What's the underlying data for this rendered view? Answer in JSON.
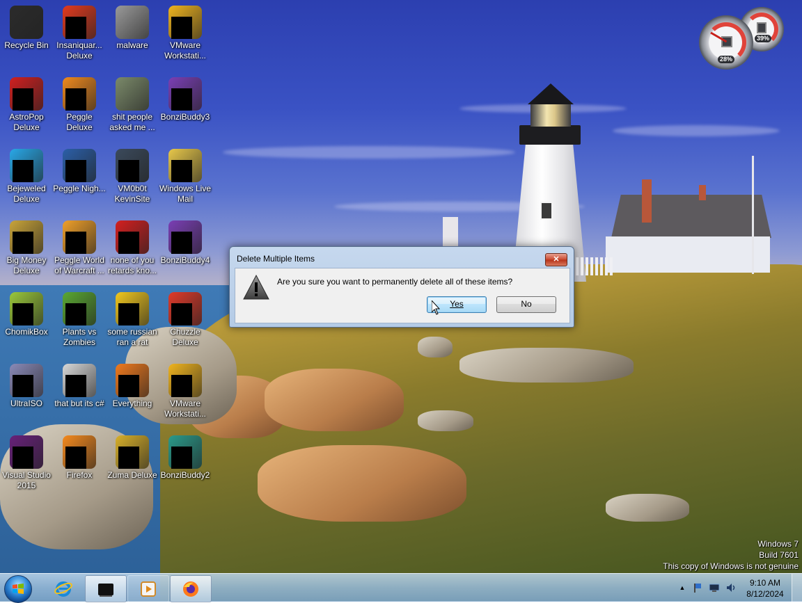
{
  "desktop": {
    "icons": [
      {
        "label": "Recycle Bin",
        "icon": "recycle-bin-icon",
        "color": "#2b2b2b",
        "redacted": false
      },
      {
        "label": "Insaniquar... Deluxe",
        "icon": "insaniquarium-icon",
        "color": "#e23a1e",
        "redacted": true
      },
      {
        "label": "malware",
        "icon": "folder-icon",
        "color": "#9a9a9a",
        "redacted": false
      },
      {
        "label": "VMware Workstati...",
        "icon": "vmware-icon",
        "color": "#f0b41e",
        "redacted": true
      },
      {
        "label": "AstroPop Deluxe",
        "icon": "astropop-icon",
        "color": "#d02020",
        "redacted": true
      },
      {
        "label": "Peggle Deluxe",
        "icon": "peggle-icon",
        "color": "#f08a1e",
        "redacted": true
      },
      {
        "label": "shit people asked me ...",
        "icon": "folder-icon",
        "color": "#7b8a6a",
        "redacted": false
      },
      {
        "label": "BonziBuddy3",
        "icon": "bonzibuddy-icon",
        "color": "#7b3fb5",
        "redacted": true
      },
      {
        "label": "Bejeweled Deluxe",
        "icon": "bejeweled-icon",
        "color": "#28a8e8",
        "redacted": true
      },
      {
        "label": "Peggle Nigh...",
        "icon": "peggle-nights-icon",
        "color": "#2b5fa8",
        "redacted": true
      },
      {
        "label": "VM0b0t KevinSite",
        "icon": "monitor-icon",
        "color": "#3b4a5c",
        "redacted": true
      },
      {
        "label": "Windows Live Mail",
        "icon": "mail-icon",
        "color": "#e8c84a",
        "redacted": true
      },
      {
        "label": "Big Money Deluxe",
        "icon": "big-money-icon",
        "color": "#c9a43a",
        "redacted": true
      },
      {
        "label": "Peggle World of Warcraft ...",
        "icon": "peggle-wow-icon",
        "color": "#f0a02a",
        "redacted": true
      },
      {
        "label": "none of you retards kno...",
        "icon": "red-circle-icon",
        "color": "#d42020",
        "redacted": true
      },
      {
        "label": "BonziBuddy4",
        "icon": "bonzibuddy-icon",
        "color": "#7b3fb5",
        "redacted": true
      },
      {
        "label": "ChomikBox",
        "icon": "chomikbox-icon",
        "color": "#9ac83a",
        "redacted": true
      },
      {
        "label": "Plants vs Zombies",
        "icon": "plants-vs-zombies-icon",
        "color": "#5aa832",
        "redacted": true
      },
      {
        "label": "some russian ran a rat",
        "icon": "lightshot-icon",
        "color": "#f2c81e",
        "redacted": true
      },
      {
        "label": "Chuzzle Deluxe",
        "icon": "chuzzle-icon",
        "color": "#e03a2a",
        "redacted": true
      },
      {
        "label": "UltraISO",
        "icon": "ultraiso-icon",
        "color": "#8a8ab8",
        "redacted": true
      },
      {
        "label": "that but its c#",
        "icon": "copy-icon",
        "color": "#d8d8d8",
        "redacted": true
      },
      {
        "label": "Everything",
        "icon": "everything-icon",
        "color": "#f07a1e",
        "redacted": true
      },
      {
        "label": "VMware Workstati...",
        "icon": "vmware-icon",
        "color": "#f0b41e",
        "redacted": true
      },
      {
        "label": "Visual Studio 2015",
        "icon": "visual-studio-icon",
        "color": "#68217a",
        "redacted": true
      },
      {
        "label": "Firefox",
        "icon": "firefox-icon",
        "color": "#f58a1e",
        "redacted": true
      },
      {
        "label": "Zuma Deluxe",
        "icon": "zuma-icon",
        "color": "#d8b02a",
        "redacted": true
      },
      {
        "label": "BonziBuddy2",
        "icon": "bonzibuddy-icon",
        "color": "#2a9a8a",
        "redacted": true
      }
    ]
  },
  "gadgets": {
    "cpu_percent": "28%",
    "memory_percent": "39%"
  },
  "dialog": {
    "title": "Delete Multiple Items",
    "close_glyph": "✕",
    "message": "Are you sure you want to permanently delete all of these items?",
    "yes_label": "Yes",
    "no_label": "No",
    "icon": "warning-icon"
  },
  "watermark": {
    "line1": "Windows 7",
    "line2": "Build 7601",
    "line3": "This copy of Windows is not genuine"
  },
  "taskbar": {
    "pinned": [
      {
        "name": "internet-explorer",
        "icon": "internet-explorer-icon",
        "active": false
      },
      {
        "name": "vm-window",
        "icon": "black-window-icon",
        "active": true
      },
      {
        "name": "windows-media-player",
        "icon": "media-player-icon",
        "active": false
      },
      {
        "name": "firefox",
        "icon": "firefox-icon",
        "active": true
      }
    ],
    "clock": {
      "time": "9:10 AM",
      "date": "8/12/2024"
    }
  },
  "colors": {
    "dialog_frame": "#b4cbe6",
    "default_button": "#bee6fd",
    "close_button": "#c9462c"
  }
}
